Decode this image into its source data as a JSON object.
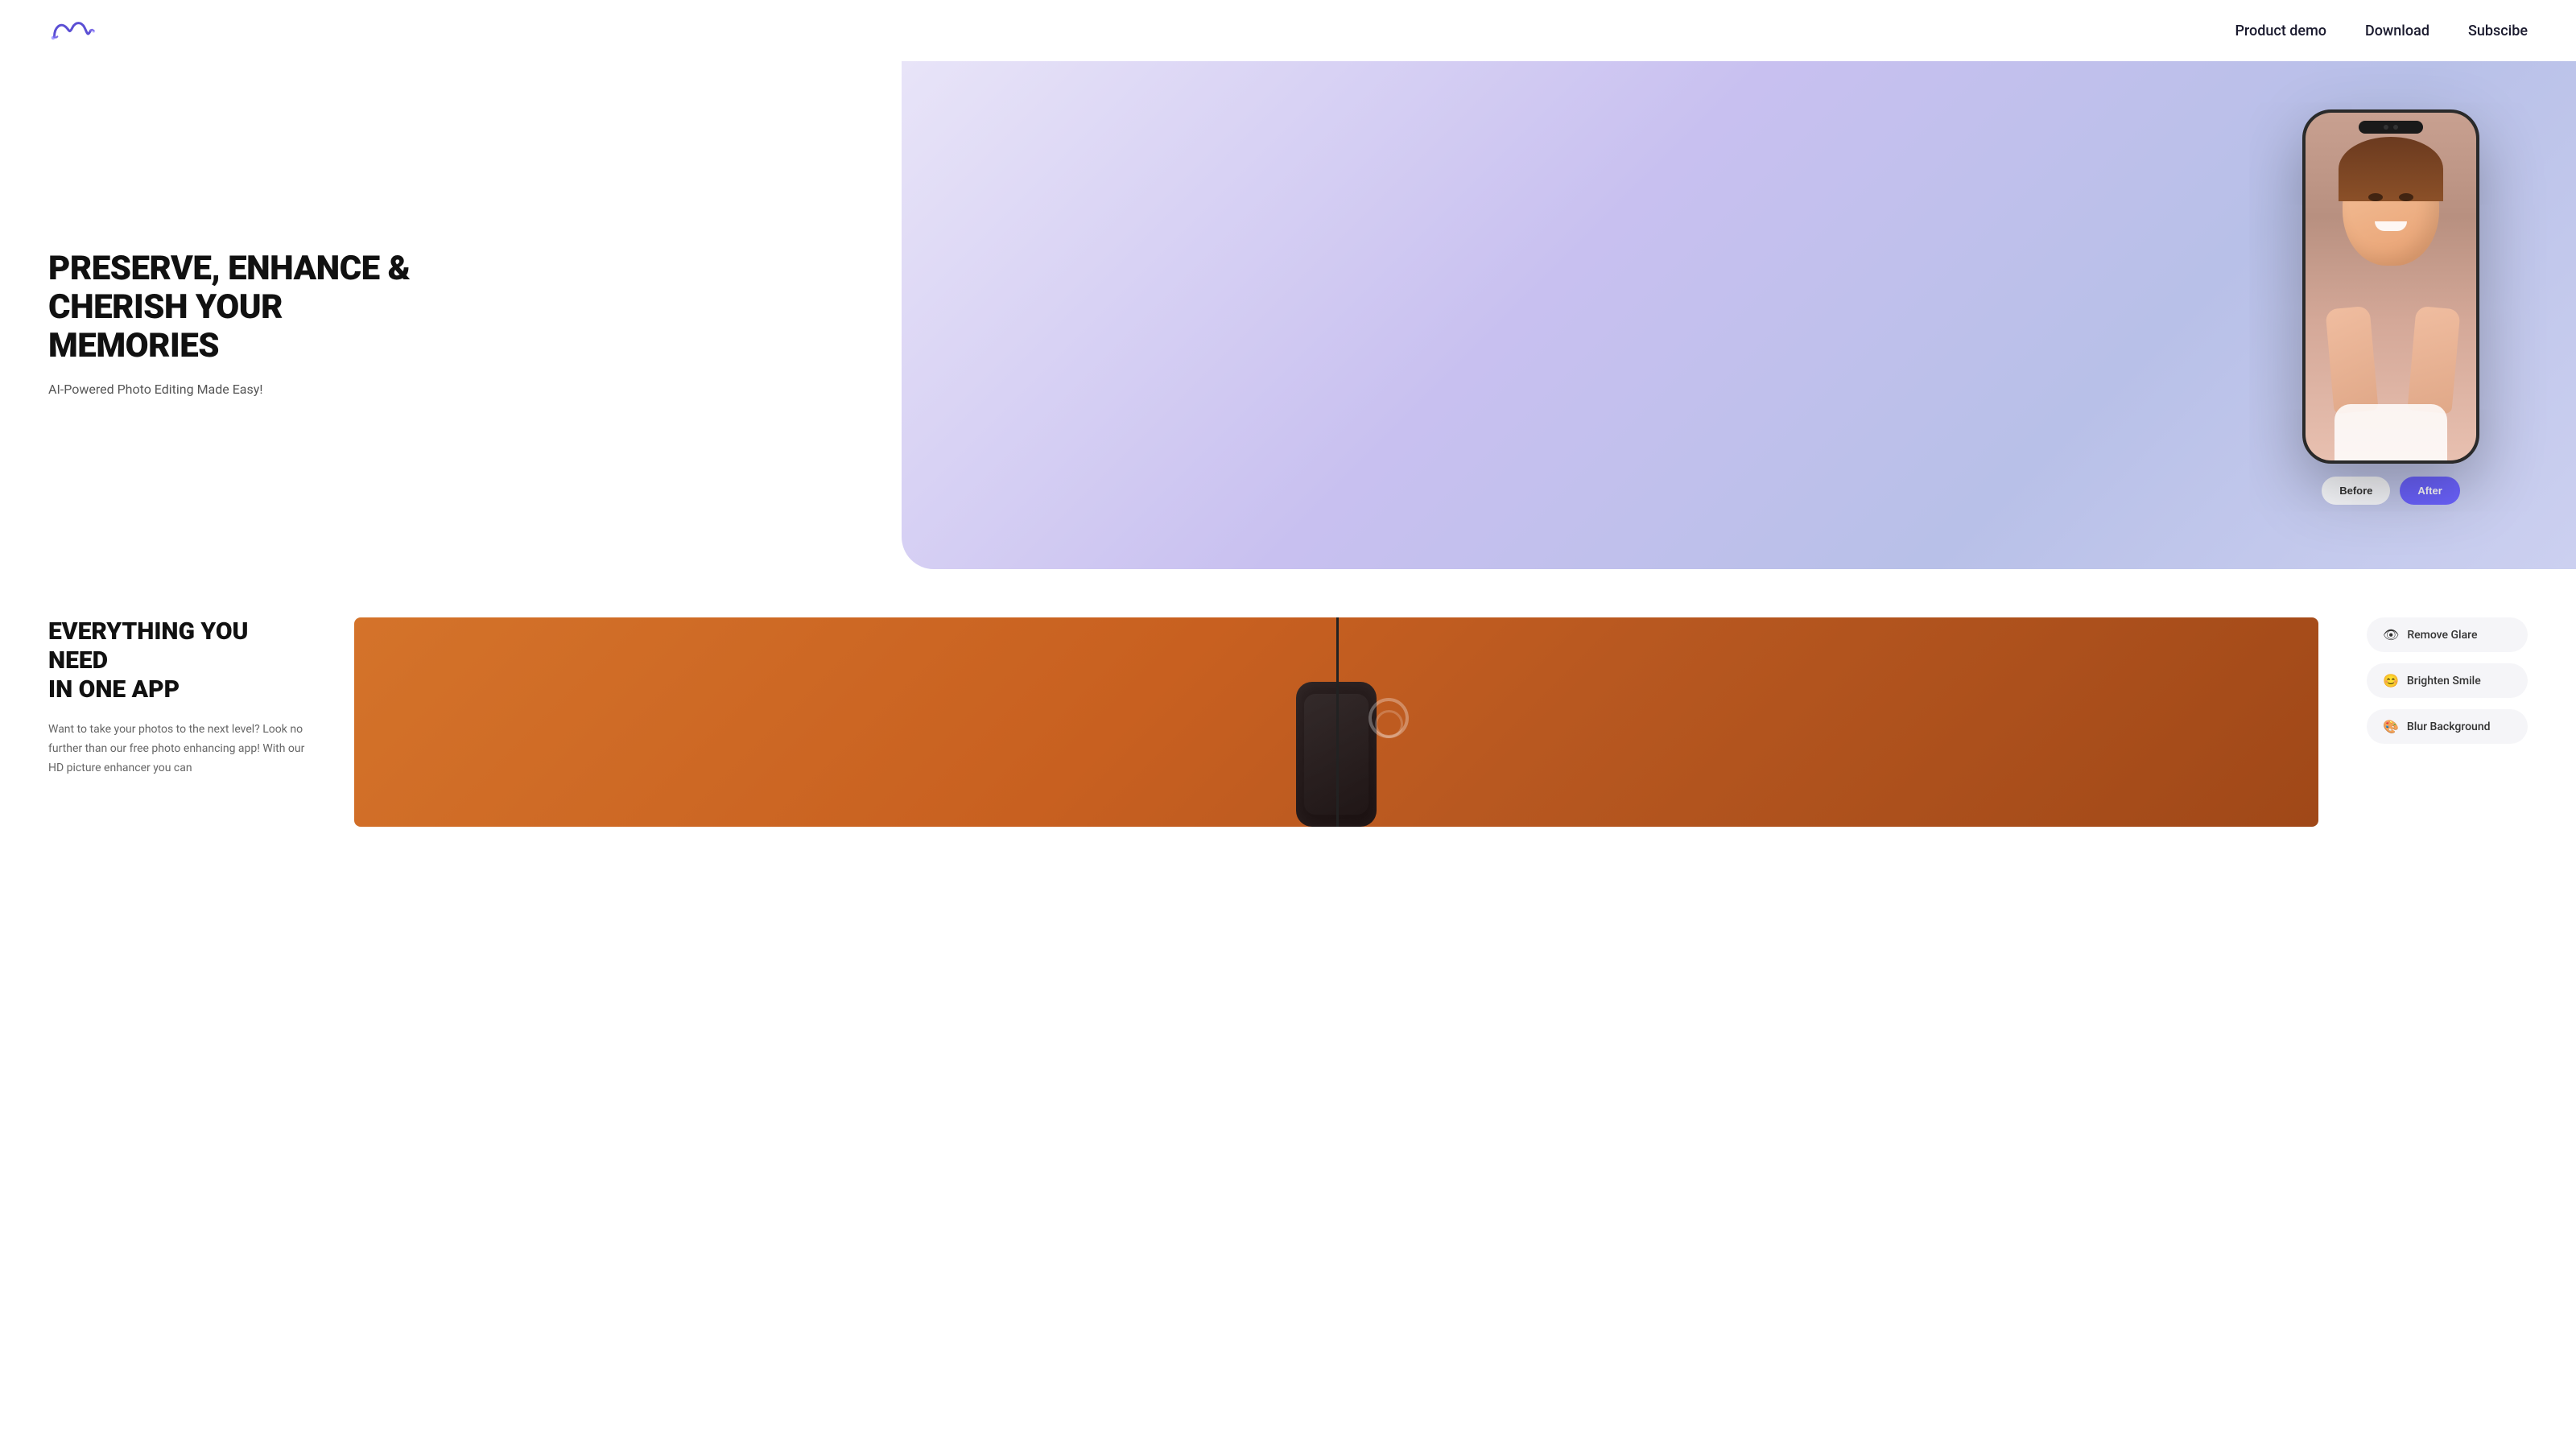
{
  "header": {
    "logo_alt": "App Logo",
    "nav": [
      {
        "id": "product-demo",
        "label": "Product demo"
      },
      {
        "id": "download",
        "label": "Download"
      },
      {
        "id": "subscribe",
        "label": "Subscibe"
      }
    ]
  },
  "hero": {
    "title_line1": "PRESERVE, ENHANCE &",
    "title_line2": "CHERISH YOUR MEMORIES",
    "subtitle": "AI-Powered Photo Editing Made Easy!",
    "phone": {
      "before_label": "Before",
      "after_label": "After"
    }
  },
  "everything": {
    "title_line1": "EVERYTHING YOU NEED",
    "title_line2": "IN ONE APP",
    "description": "Want to take your photos to the next level? Look no further than our free photo enhancing app! With our HD picture enhancer you can",
    "features": [
      {
        "id": "remove-glare",
        "icon": "👁",
        "label": "Remove Glare"
      },
      {
        "id": "brighten-smile",
        "icon": "😊",
        "label": "Brighten Smile"
      },
      {
        "id": "blur-bg",
        "icon": "🎨",
        "label": "Blur Background"
      }
    ]
  },
  "colors": {
    "accent": "#6c63ff",
    "dark": "#111111",
    "text_muted": "#666666",
    "hero_bg": "#c8c0f0",
    "chip_bg": "#f5f5f8"
  }
}
